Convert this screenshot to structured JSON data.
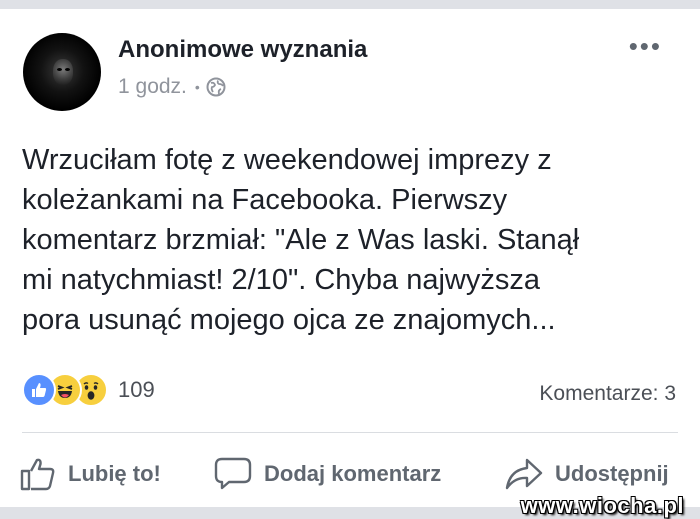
{
  "post": {
    "page_name": "Anonimowe wyznania",
    "time": "1 godz.",
    "visibility_icon": "globe-icon",
    "more_icon": "more-options-icon",
    "text": "Wrzuciłam fotę z weekendowej imprezy z\nkoleżankami na Facebooka. Pierwszy\nkomentarz brzmiał: \"Ale z Was laski. Stanął\nmi natychmiast! 2/10\". Chyba najwyższa\npora usunąć mojego ojca ze znajomych..."
  },
  "reactions": {
    "icons": [
      "like-reaction-icon",
      "haha-reaction-icon",
      "wow-reaction-icon"
    ],
    "count": "109"
  },
  "comments": {
    "label": "Komentarze: 3"
  },
  "actions": {
    "like_label": "Lubię to!",
    "comment_label": "Dodaj komentarz",
    "share_label": "Udostępnij"
  },
  "watermark": "www.wiocha.pl",
  "colors": {
    "like_blue": "#5890ff",
    "reaction_yellow": "#f7cf3e",
    "secondary_text": "#90949c",
    "action_text": "#606770"
  }
}
